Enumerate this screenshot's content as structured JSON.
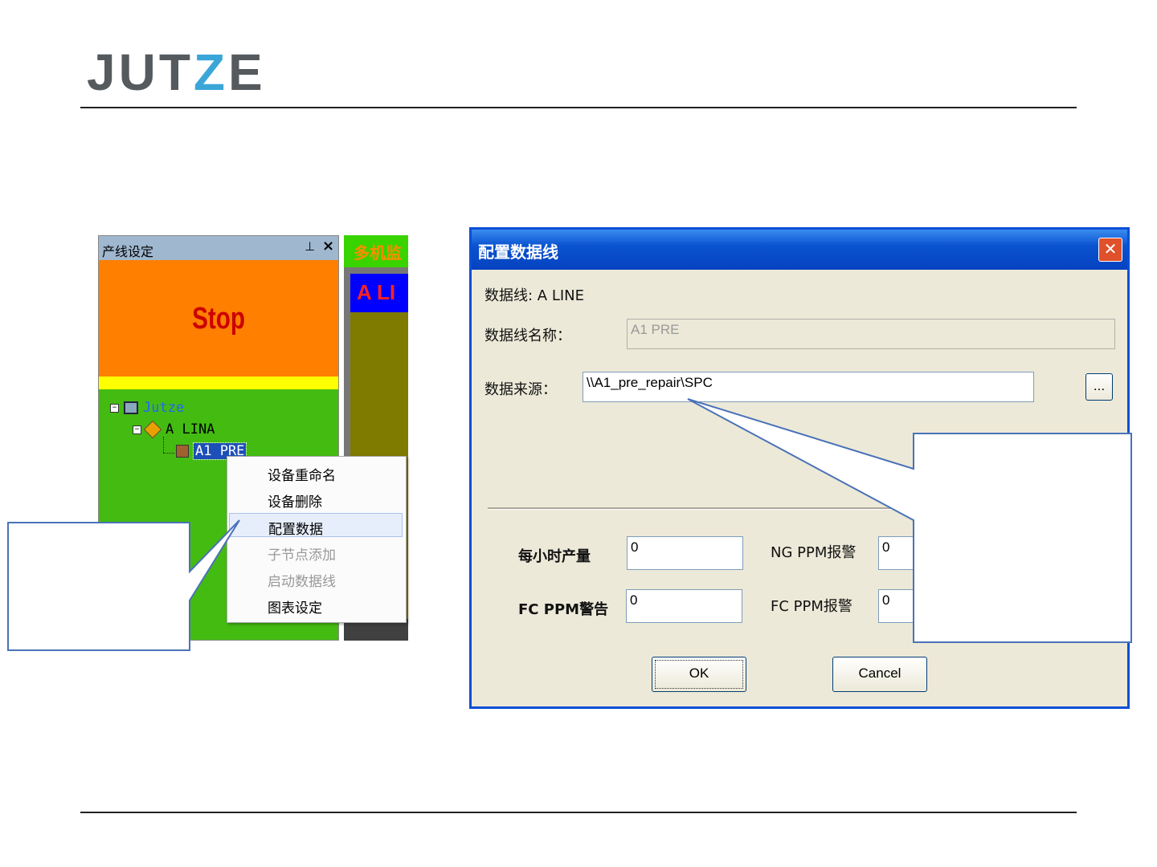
{
  "slide": {
    "logo_main": "JUT",
    "logo_z": "Z",
    "logo_end": "E"
  },
  "panel": {
    "title": "产线设定",
    "pin_icon": "⊥",
    "close_icon": "×",
    "status": "Stop",
    "tree": {
      "root": "Jutze",
      "line": "A LINA",
      "device": "A1 PRE"
    }
  },
  "tab2": {
    "label": "多机监",
    "banner": "A LI"
  },
  "context_menu": {
    "items": [
      {
        "label": "设备重命名",
        "enabled": true
      },
      {
        "label": "设备删除",
        "enabled": true
      },
      {
        "label": "配置数据",
        "enabled": true,
        "highlighted": true
      },
      {
        "label": "子节点添加",
        "enabled": false
      },
      {
        "label": "启动数据线",
        "enabled": false
      },
      {
        "label": "图表设定",
        "enabled": true
      }
    ]
  },
  "dialog": {
    "title": "配置数据线",
    "close_icon": "✕",
    "data_line_label": "数据线: A LINE",
    "name_label": "数据线名称：",
    "name_value": "A1 PRE",
    "source_label": "数据来源：",
    "source_value": "\\\\A1_pre_repair\\SPC",
    "browse_label": "...",
    "hourly_label": "每小时产量",
    "hourly_value": "0",
    "ng_alarm_label": "NG PPM报警",
    "ng_alarm_value": "0",
    "fc_warn_label": "FC PPM警告",
    "fc_warn_value": "0",
    "fc_alarm_label": "FC PPM报警",
    "fc_alarm_value": "0",
    "ok_label": "OK",
    "cancel_label": "Cancel"
  },
  "colors": {
    "accent_blue": "#4a72b8",
    "panel_green": "#44bb11",
    "stop_orange": "#ff7f00",
    "logo_z": "#3aa6d8"
  }
}
